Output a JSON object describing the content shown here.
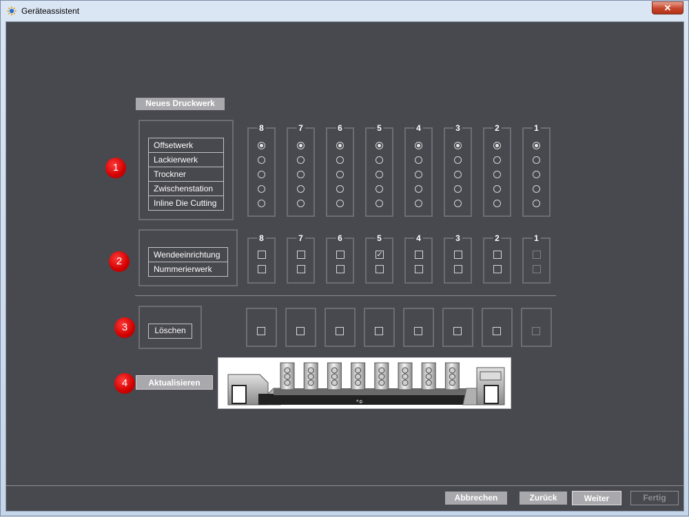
{
  "window": {
    "title": "Geräteassistent",
    "close_label": "✕"
  },
  "section_title": "Neues Druckwerk",
  "badges": [
    "1",
    "2",
    "3",
    "4"
  ],
  "unit_types": [
    "Offsetwerk",
    "Lackierwerk",
    "Trockner",
    "Zwischenstation",
    "Inline Die Cutting"
  ],
  "options": [
    "Wendeeinrichtung",
    "Nummerierwerk"
  ],
  "units": [
    "8",
    "7",
    "6",
    "5",
    "4",
    "3",
    "2",
    "1"
  ],
  "unit_type_selection": [
    "Offsetwerk",
    "Offsetwerk",
    "Offsetwerk",
    "Offsetwerk",
    "Offsetwerk",
    "Offsetwerk",
    "Offsetwerk",
    "Offsetwerk"
  ],
  "option_states": {
    "Wendeeinrichtung": [
      false,
      false,
      false,
      true,
      false,
      false,
      false,
      false
    ],
    "Nummerierwerk": [
      false,
      false,
      false,
      false,
      false,
      false,
      false,
      false
    ]
  },
  "disabled_units": [
    "1"
  ],
  "delete_label": "Löschen",
  "refresh_label": "Aktualisieren",
  "footer": {
    "cancel": "Abbrechen",
    "back": "Zurück",
    "next": "Weiter",
    "finish": "Fertig"
  }
}
